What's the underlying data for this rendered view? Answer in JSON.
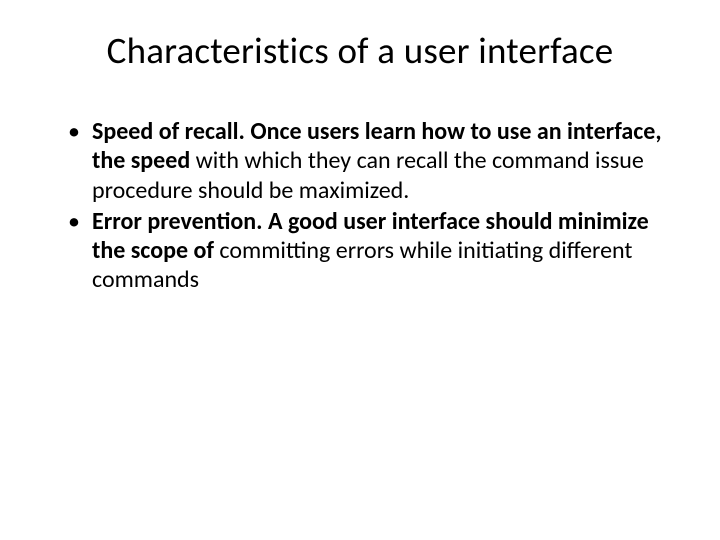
{
  "slide": {
    "title": "Characteristics of a user interface",
    "bullets": [
      {
        "bold": "Speed of recall. Once users learn how to use an interface, the speed ",
        "regular": "with which they can recall the command issue procedure should be maximized."
      },
      {
        "bold": "Error prevention. A good user interface should minimize the scope of ",
        "regular": "committing errors while initiating different commands"
      }
    ]
  }
}
